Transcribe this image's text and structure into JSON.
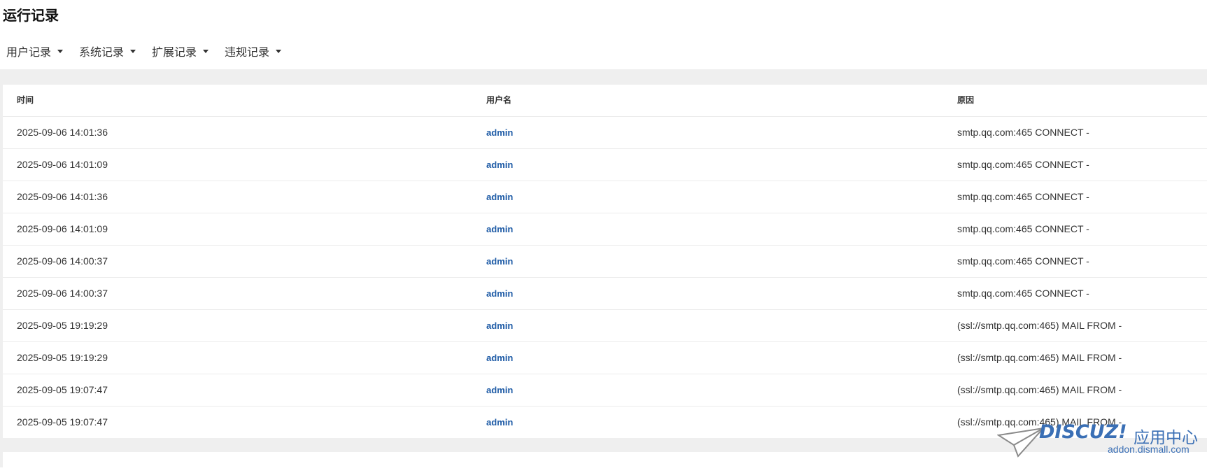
{
  "page": {
    "title": "运行记录"
  },
  "menu": [
    {
      "label": "用户记录"
    },
    {
      "label": "系统记录"
    },
    {
      "label": "扩展记录"
    },
    {
      "label": "违规记录"
    }
  ],
  "table": {
    "columns": [
      "时间",
      "用户名",
      "原因"
    ],
    "rows": [
      {
        "time": "2025-09-06 14:01:36",
        "user": "admin",
        "reason": "smtp.qq.com:465 CONNECT -"
      },
      {
        "time": "2025-09-06 14:01:09",
        "user": "admin",
        "reason": "smtp.qq.com:465 CONNECT -"
      },
      {
        "time": "2025-09-06 14:01:36",
        "user": "admin",
        "reason": "smtp.qq.com:465 CONNECT -"
      },
      {
        "time": "2025-09-06 14:01:09",
        "user": "admin",
        "reason": "smtp.qq.com:465 CONNECT -"
      },
      {
        "time": "2025-09-06 14:00:37",
        "user": "admin",
        "reason": "smtp.qq.com:465 CONNECT -"
      },
      {
        "time": "2025-09-06 14:00:37",
        "user": "admin",
        "reason": "smtp.qq.com:465 CONNECT -"
      },
      {
        "time": "2025-09-05 19:19:29",
        "user": "admin",
        "reason": "(ssl://smtp.qq.com:465) MAIL FROM -"
      },
      {
        "time": "2025-09-05 19:19:29",
        "user": "admin",
        "reason": "(ssl://smtp.qq.com:465) MAIL FROM -"
      },
      {
        "time": "2025-09-05 19:07:47",
        "user": "admin",
        "reason": "(ssl://smtp.qq.com:465) MAIL FROM -"
      },
      {
        "time": "2025-09-05 19:07:47",
        "user": "admin",
        "reason": "(ssl://smtp.qq.com:465) MAIL FROM -"
      }
    ]
  },
  "watermark": {
    "brand": "DISCUZ!",
    "center": "应用中心",
    "domain": "addon.dismall.com"
  },
  "colors": {
    "link": "#1e5ba6",
    "background_band": "#efefef",
    "watermark": "#3a6fb5"
  }
}
